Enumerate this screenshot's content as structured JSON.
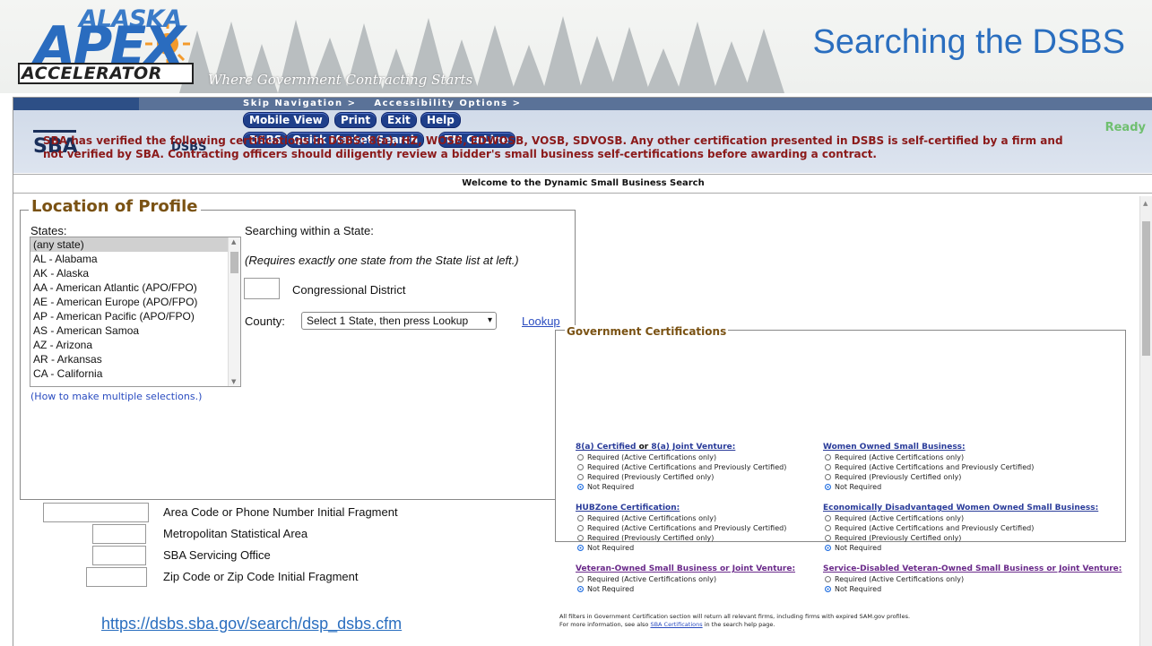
{
  "slide": {
    "logo_top": "ALASKA",
    "logo_main": "APEX",
    "logo_bottom": "ACCELERATOR",
    "tagline": "Where Government Contracting Starts",
    "title": "Searching the DSBS",
    "url": "https://dsbs.sba.gov/search/dsp_dsbs.cfm"
  },
  "header": {
    "skip_nav": "Skip Navigation >",
    "accessibility": "Accessibility Options >",
    "logo": "SBA",
    "app_label": "DSBS",
    "buttons": [
      "Mobile View",
      "Print",
      "Exit",
      "Help",
      "DSBS",
      "Quick Market Search",
      "TM OnLine"
    ],
    "status": "Ready"
  },
  "welcome": "Welcome to the Dynamic Small Business Search",
  "notice": "SBA has verified the following certifications in DSBS: 8(a), HZ, WOSB, EDWOSB, VOSB, SDVOSB. Any other certification presented in DSBS is self-certified by a firm and not verified by SBA. Contracting officers should diligently review a bidder's small business self-certifications before awarding a contract.",
  "location": {
    "legend": "Location of Profile",
    "states_label": "States:",
    "states": [
      "(any state)",
      "AL - Alabama",
      "AK - Alaska",
      "AA - American Atlantic (APO/FPO)",
      "AE - American Europe (APO/FPO)",
      "AP - American Pacific (APO/FPO)",
      "AS - American Samoa",
      "AZ - Arizona",
      "AR - Arkansas",
      "CA - California"
    ],
    "selected_state": "(any state)",
    "how_to": "(How to make multiple selections.)",
    "within_label": "Searching within a State:",
    "requires_note": "(Requires exactly one state from the State list at left.)",
    "congressional_label": "Congressional District",
    "county_label": "County:",
    "county_value": "Select 1 State, then press Lookup",
    "lookup": "Lookup",
    "area_code_label": "Area Code or Phone Number Initial Fragment",
    "msa_label": "Metropolitan Statistical Area",
    "servicing_label": "SBA Servicing Office",
    "zip_label": "Zip Code or Zip Code Initial Fragment"
  },
  "gov_certs": {
    "legend": "Government Certifications",
    "groups": [
      {
        "title": "8(a) Certified",
        "joiner": " or ",
        "title2": "8(a) Joint Venture:",
        "options": [
          "Required (Active Certifications only)",
          "Required (Active Certifications and Previously Certified)",
          "Required (Previously Certified only)",
          "Not Required"
        ],
        "selected": 3
      },
      {
        "title": "Women Owned Small Business:",
        "options": [
          "Required (Active Certifications only)",
          "Required (Active Certifications and Previously Certified)",
          "Required (Previously Certified only)",
          "Not Required"
        ],
        "selected": 3
      },
      {
        "title": "HUBZone Certification:",
        "options": [
          "Required (Active Certifications only)",
          "Required (Active Certifications and Previously Certified)",
          "Required (Previously Certified only)",
          "Not Required"
        ],
        "selected": 3
      },
      {
        "title": "Economically Disadvantaged Women Owned Small Business:",
        "options": [
          "Required (Active Certifications only)",
          "Required (Active Certifications and Previously Certified)",
          "Required (Previously Certified only)",
          "Not Required"
        ],
        "selected": 3
      },
      {
        "title": "Veteran-Owned Small Business or Joint Venture:",
        "options": [
          "Required (Active Certifications only)",
          "Not Required"
        ],
        "selected": 1
      },
      {
        "title": "Service-Disabled Veteran-Owned Small Business or Joint Venture:",
        "options": [
          "Required (Active Certifications only)",
          "Not Required"
        ],
        "selected": 1
      }
    ],
    "footer_line1": "All filters in Government Certification section will return all relevant firms, including firms with expired SAM.gov profiles.",
    "footer_line2_pre": "For more information, see also ",
    "footer_link": "SBA Certifications",
    "footer_line2_post": " in the search help page."
  }
}
